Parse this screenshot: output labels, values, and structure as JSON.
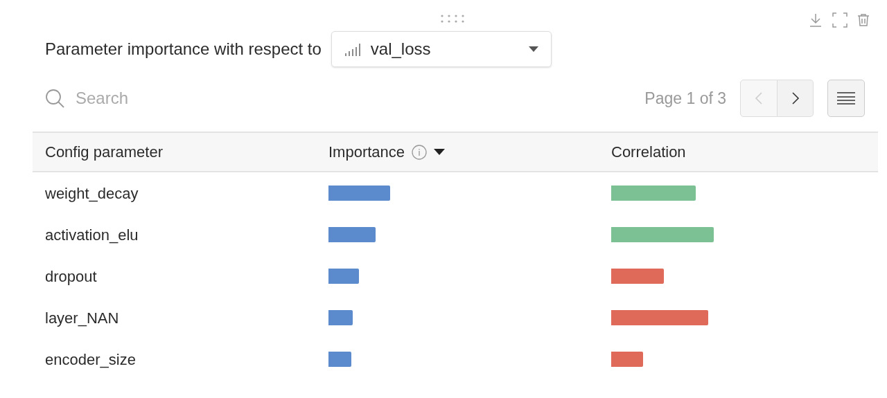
{
  "header": {
    "label": "Parameter importance with respect to",
    "metric": "val_loss"
  },
  "search": {
    "placeholder": "Search"
  },
  "pagination": {
    "label": "Page 1 of 3",
    "prev_disabled": true,
    "next_disabled": false
  },
  "table": {
    "columns": [
      "Config parameter",
      "Importance",
      "Correlation"
    ],
    "rows": [
      {
        "name": "weight_decay",
        "correlation": {
          "color": "#7bc194"
        }
      },
      {
        "name": "activation_elu",
        "correlation": {
          "color": "#7bc194"
        }
      },
      {
        "name": "dropout",
        "correlation": {
          "color": "#e06a59"
        }
      },
      {
        "name": "layer_NAN",
        "correlation": {
          "color": "#e06a59"
        }
      },
      {
        "name": "encoder_size",
        "correlation": {
          "color": "#e06a59"
        }
      }
    ]
  }
}
